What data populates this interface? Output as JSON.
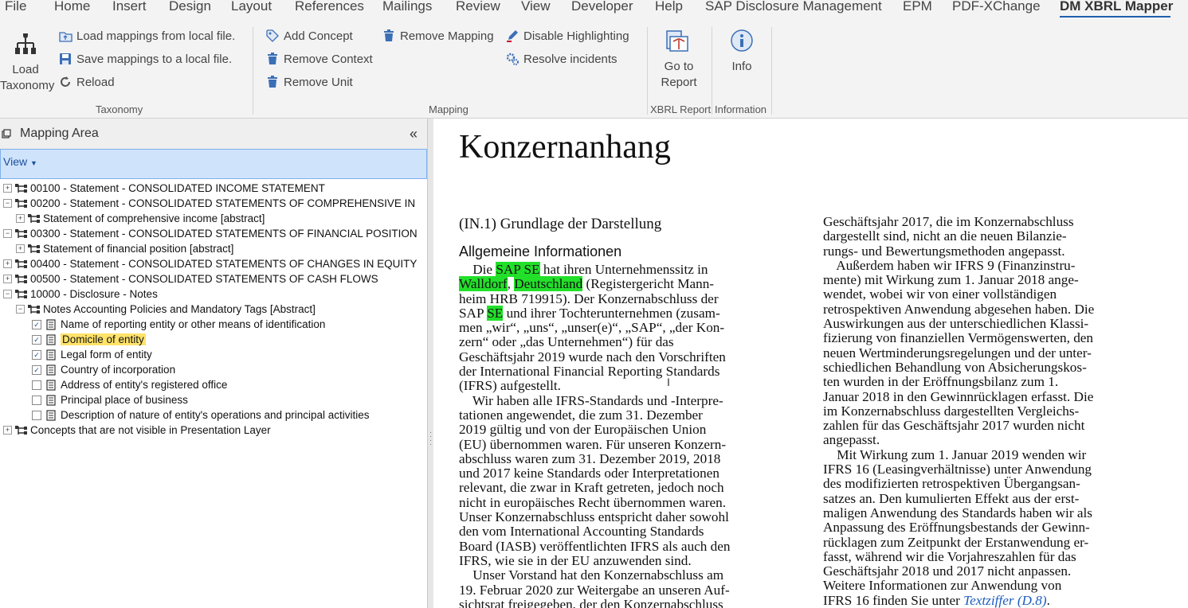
{
  "menu": {
    "tabs": [
      "File",
      "Home",
      "Insert",
      "Design",
      "Layout",
      "References",
      "Mailings",
      "Review",
      "View",
      "Developer",
      "Help",
      "SAP Disclosure Management",
      "EPM",
      "PDF-XChange",
      "DM XBRL Mapper"
    ],
    "active_tab": "DM XBRL Mapper"
  },
  "ribbon": {
    "taxonomy": {
      "load_taxonomy_line1": "Load",
      "load_taxonomy_line2": "Taxonomy",
      "load_mappings": "Load mappings from local file.",
      "save_mappings": "Save mappings to a local file.",
      "reload": "Reload",
      "group_label": "Taxonomy"
    },
    "mapping": {
      "add_concept": "Add Concept",
      "remove_context": "Remove Context",
      "remove_unit": "Remove Unit",
      "remove_mapping": "Remove Mapping",
      "disable_highlighting": "Disable Highlighting",
      "resolve_incidents": "Resolve incidents",
      "group_label": "Mapping"
    },
    "xbrl_report": {
      "go_to_report_line1": "Go to",
      "go_to_report_line2": "Report",
      "group_label": "XBRL Report"
    },
    "information": {
      "info": "Info",
      "group_label": "Information"
    }
  },
  "mapping_area": {
    "title": "Mapping Area",
    "view_label": "View",
    "tree": [
      {
        "label": "00100 - Statement - CONSOLIDATED INCOME STATEMENT",
        "level": 0,
        "expand": "+",
        "checked": null,
        "selected": false
      },
      {
        "label": "00200 - Statement - CONSOLIDATED STATEMENTS OF COMPREHENSIVE IN",
        "level": 0,
        "expand": "−",
        "checked": null,
        "selected": false
      },
      {
        "label": "Statement of comprehensive income [abstract]",
        "level": 1,
        "expand": "+",
        "checked": null,
        "selected": false
      },
      {
        "label": "00300 - Statement - CONSOLIDATED STATEMENTS OF FINANCIAL POSITION",
        "level": 0,
        "expand": "−",
        "checked": null,
        "selected": false
      },
      {
        "label": "Statement of financial position [abstract]",
        "level": 1,
        "expand": "+",
        "checked": null,
        "selected": false
      },
      {
        "label": "00400 - Statement - CONSOLIDATED STATEMENTS OF CHANGES IN EQUITY",
        "level": 0,
        "expand": "+",
        "checked": null,
        "selected": false
      },
      {
        "label": "00500 - Statement - CONSOLIDATED STATEMENTS OF CASH FLOWS",
        "level": 0,
        "expand": "+",
        "checked": null,
        "selected": false
      },
      {
        "label": "10000 - Disclosure - Notes",
        "level": 0,
        "expand": "−",
        "checked": null,
        "selected": false
      },
      {
        "label": "Notes Accounting Policies and Mandatory Tags [Abstract]",
        "level": 1,
        "expand": "−",
        "checked": null,
        "selected": false
      },
      {
        "label": "Name of reporting entity or other means of identification",
        "level": 2,
        "expand": null,
        "checked": true,
        "selected": false
      },
      {
        "label": "Domicile of entity",
        "level": 2,
        "expand": null,
        "checked": true,
        "selected": true
      },
      {
        "label": "Legal form of entity",
        "level": 2,
        "expand": null,
        "checked": true,
        "selected": false
      },
      {
        "label": "Country of incorporation",
        "level": 2,
        "expand": null,
        "checked": true,
        "selected": false
      },
      {
        "label": "Address of entity's registered office",
        "level": 2,
        "expand": null,
        "checked": false,
        "selected": false
      },
      {
        "label": "Principal place of business",
        "level": 2,
        "expand": null,
        "checked": false,
        "selected": false
      },
      {
        "label": "Description of nature of entity's operations and principal activities",
        "level": 2,
        "expand": null,
        "checked": false,
        "selected": false
      },
      {
        "label": "Concepts that are not visible in Presentation Layer",
        "level": 0,
        "expand": "+",
        "checked": null,
        "selected": false
      }
    ]
  },
  "document": {
    "title": "Konzernanhang",
    "section_heading": "(IN.1)  Grundlage der Darstellung",
    "sub_heading": "Allgemeine Informationen",
    "left_column": [
      [
        {
          "t": "    Die "
        },
        {
          "t": "SAP SE",
          "hl": true
        },
        {
          "t": " hat ihren Unternehmenssitz in"
        }
      ],
      [
        {
          "t": "Walldorf",
          "hl": true
        },
        {
          "t": ", "
        },
        {
          "t": "Deutschland",
          "hl": true
        },
        {
          "t": " (Registergericht Mann-"
        }
      ],
      [
        {
          "t": "heim HRB 719915). Der Konzernabschluss der"
        }
      ],
      [
        {
          "t": "SAP "
        },
        {
          "t": "SE",
          "hl": true
        },
        {
          "t": " und ihrer Tochterunternehmen (zusam-"
        }
      ],
      [
        {
          "t": "men „wir“, „uns“, „unser(e)“, „SAP“, „der Kon-"
        }
      ],
      [
        {
          "t": "zern“ oder „das Unternehmen“) für das"
        }
      ],
      [
        {
          "t": "Geschäftsjahr 2019 wurde nach den Vorschriften"
        }
      ],
      [
        {
          "t": "der International Financial Reporting Standards"
        }
      ],
      [
        {
          "t": "(IFRS) aufgestellt."
        }
      ],
      [
        {
          "t": "    Wir haben alle IFRS-Standards und -Interpre-"
        }
      ],
      [
        {
          "t": "tationen angewendet, die zum 31. Dezember"
        }
      ],
      [
        {
          "t": "2019 gültig und von der Europäischen Union"
        }
      ],
      [
        {
          "t": "(EU) übernommen waren. Für unseren Konzern-"
        }
      ],
      [
        {
          "t": "abschluss waren zum 31. Dezember 2019, 2018"
        }
      ],
      [
        {
          "t": "und 2017 keine Standards oder Interpretationen"
        }
      ],
      [
        {
          "t": "relevant, die zwar in Kraft getreten, jedoch noch"
        }
      ],
      [
        {
          "t": "nicht in europäisches Recht übernommen waren."
        }
      ],
      [
        {
          "t": "Unser Konzernabschluss entspricht daher sowohl"
        }
      ],
      [
        {
          "t": "den vom International Accounting Standards"
        }
      ],
      [
        {
          "t": "Board (IASB) veröffentlichten IFRS als auch den"
        }
      ],
      [
        {
          "t": "IFRS, wie sie in der EU anzuwenden sind."
        }
      ],
      [
        {
          "t": "    Unser Vorstand hat den Konzernabschluss am"
        }
      ],
      [
        {
          "t": "19. Februar 2020 zur Weitergabe an unseren Auf-"
        }
      ],
      [
        {
          "t": "sichtsrat freigegeben, der den Konzernabschluss"
        }
      ]
    ],
    "right_column": [
      [
        {
          "t": "Geschäftsjahr 2017, die im Konzernabschluss"
        }
      ],
      [
        {
          "t": "dargestellt sind, nicht an die neuen Bilanzie-"
        }
      ],
      [
        {
          "t": "rungs- und Bewertungsmethoden angepasst."
        }
      ],
      [
        {
          "t": "    Außerdem haben wir IFRS 9 (Finanzinstru-"
        }
      ],
      [
        {
          "t": "mente) mit Wirkung zum 1. Januar 2018 ange-"
        }
      ],
      [
        {
          "t": "wendet, wobei wir von einer vollständigen"
        }
      ],
      [
        {
          "t": "retrospektiven Anwendung abgesehen haben. Die"
        }
      ],
      [
        {
          "t": "Auswirkungen aus der unterschiedlichen Klassi-"
        }
      ],
      [
        {
          "t": "fizierung von finanziellen Vermögenswerten, den"
        }
      ],
      [
        {
          "t": "neuen Wertminderungsregelungen und der unter-"
        }
      ],
      [
        {
          "t": "schiedlichen Behandlung von Absicherungskos-"
        }
      ],
      [
        {
          "t": "ten wurden in der Eröffnungsbilanz zum 1."
        }
      ],
      [
        {
          "t": "Januar 2018 in den Gewinnrücklagen erfasst. Die"
        }
      ],
      [
        {
          "t": "im Konzernabschluss dargestellten Vergleichs-"
        }
      ],
      [
        {
          "t": "zahlen für das Geschäftsjahr 2017 wurden nicht"
        }
      ],
      [
        {
          "t": "angepasst."
        }
      ],
      [
        {
          "t": "    Mit Wirkung zum 1. Januar 2019 wenden wir"
        }
      ],
      [
        {
          "t": "IFRS 16 (Leasingverhältnisse) unter Anwendung"
        }
      ],
      [
        {
          "t": "des modifizierten retrospektiven Übergangsan-"
        }
      ],
      [
        {
          "t": "satzes an. Den kumulierten Effekt aus der erst-"
        }
      ],
      [
        {
          "t": "maligen Anwendung des Standards haben wir als"
        }
      ],
      [
        {
          "t": "Anpassung des Eröffnungsbestands der Gewinn-"
        }
      ],
      [
        {
          "t": "rücklagen zum Zeitpunkt der Erstanwendung er-"
        }
      ],
      [
        {
          "t": "fasst, während wir die Vorjahreszahlen für das"
        }
      ],
      [
        {
          "t": "Geschäftsjahr 2018 und 2017 nicht anpassen."
        }
      ],
      [
        {
          "t": "Weitere Informationen zur Anwendung von"
        }
      ],
      [
        {
          "t": "IFRS 16 finden Sie unter "
        },
        {
          "t": "Textziffer (D.8)",
          "link": true
        },
        {
          "t": "."
        }
      ]
    ]
  },
  "colors": {
    "highlight": "#22e02a",
    "selection": "#ffe36a",
    "accent": "#1e5fae",
    "link": "#1b5cc0"
  }
}
